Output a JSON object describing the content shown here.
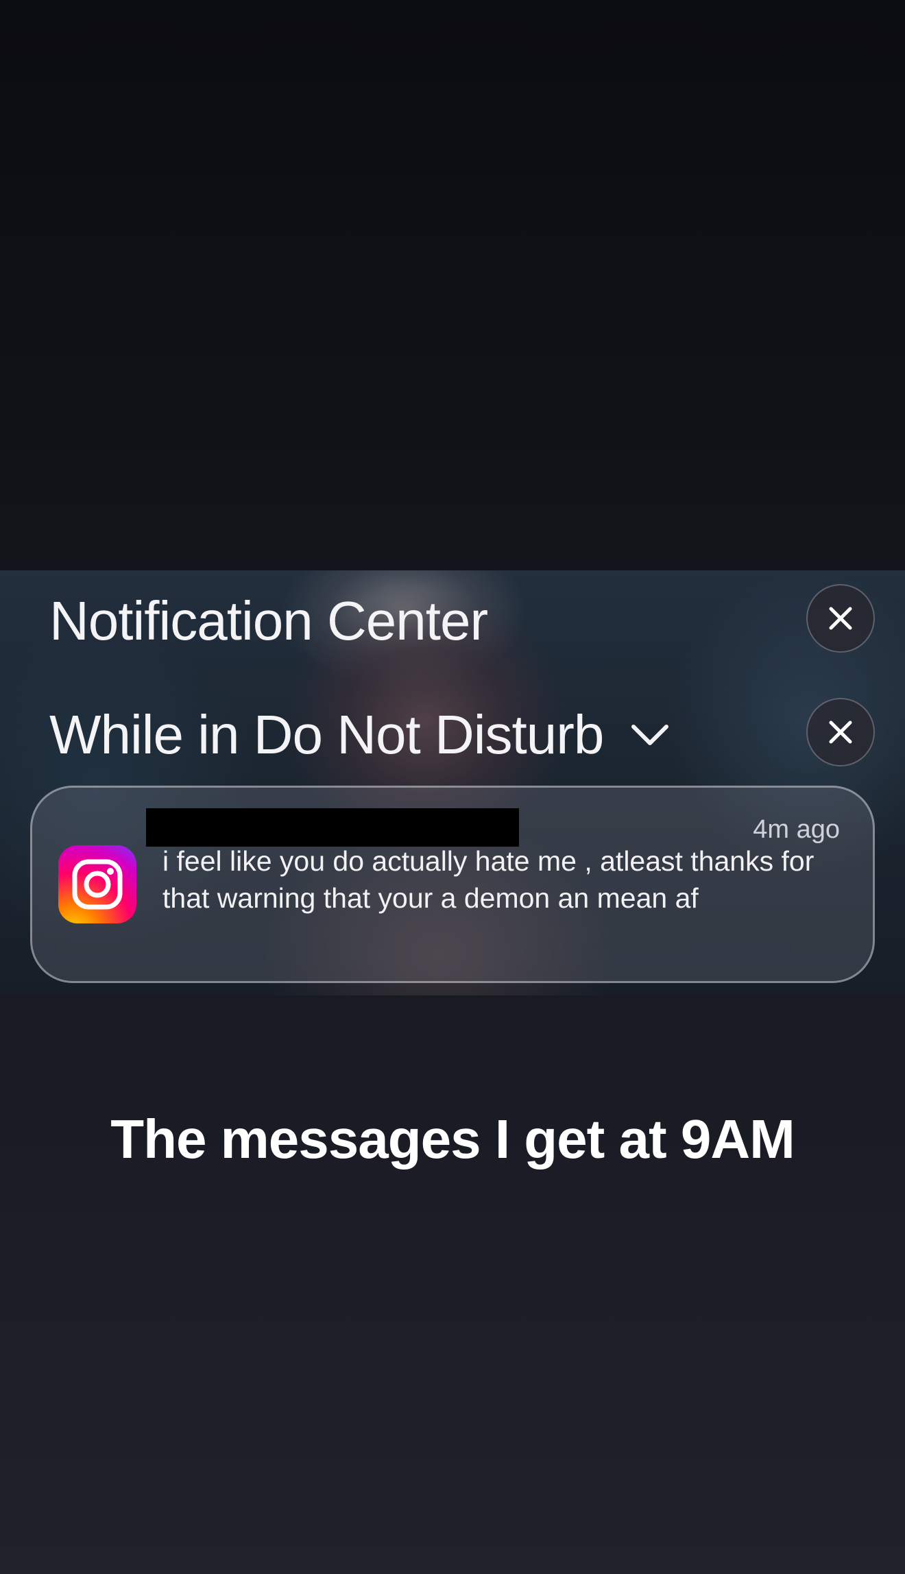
{
  "notification_center": {
    "title": "Notification Center",
    "section_title": "While in Do Not Disturb",
    "notification": {
      "app_icon": "instagram-icon",
      "sender": "",
      "timestamp": "4m ago",
      "message": "i feel like you do actually hate me , atleast thanks for that warning that your a demon an mean af"
    }
  },
  "caption": {
    "text": "The messages I get at 9AM"
  },
  "colors": {
    "background_top": "#0b0c12",
    "background_bottom": "#20212b",
    "text_primary": "#f4f4f6",
    "redaction": "#000000"
  }
}
